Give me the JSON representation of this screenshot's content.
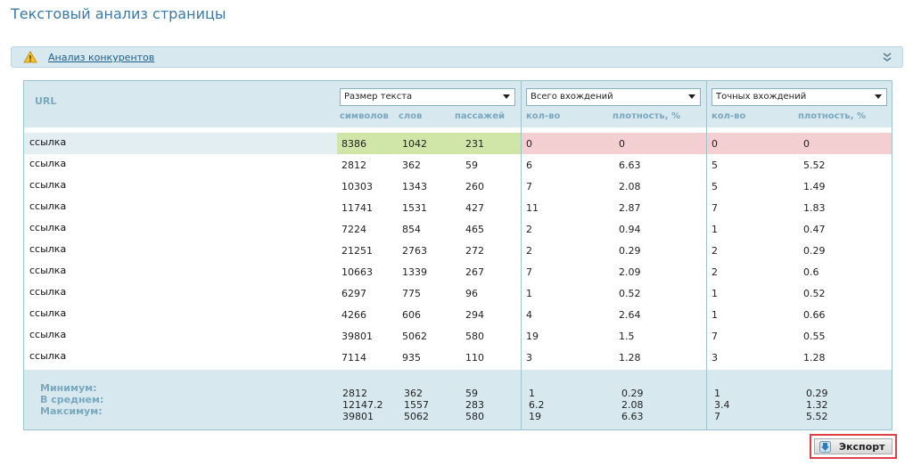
{
  "page": {
    "title": "Текстовый анализ страницы"
  },
  "competitors": {
    "link_label": "Анализ конкурентов",
    "warning_icon": "warning-icon",
    "collapse_icon": "double-chevron-icon"
  },
  "table": {
    "url_header": "URL",
    "groups": [
      {
        "select_value": "Размер текста",
        "subcols": [
          "символов",
          "слов",
          "пассажей"
        ]
      },
      {
        "select_value": "Всего вхождений",
        "subcols": [
          "кол-во",
          "плотность, %"
        ]
      },
      {
        "select_value": "Точных вхождений",
        "subcols": [
          "кол-во",
          "плотность, %"
        ]
      }
    ],
    "rows": [
      {
        "url": "ссылка",
        "symbols": "8386",
        "words": "1042",
        "passages": "231",
        "total_count": "0",
        "total_density": "0",
        "exact_count": "0",
        "exact_density": "0"
      },
      {
        "url": "ссылка",
        "symbols": "2812",
        "words": "362",
        "passages": "59",
        "total_count": "6",
        "total_density": "6.63",
        "exact_count": "5",
        "exact_density": "5.52"
      },
      {
        "url": "ссылка",
        "symbols": "10303",
        "words": "1343",
        "passages": "260",
        "total_count": "7",
        "total_density": "2.08",
        "exact_count": "5",
        "exact_density": "1.49"
      },
      {
        "url": "ссылка",
        "symbols": "11741",
        "words": "1531",
        "passages": "427",
        "total_count": "11",
        "total_density": "2.87",
        "exact_count": "7",
        "exact_density": "1.83"
      },
      {
        "url": "ссылка",
        "symbols": "7224",
        "words": "854",
        "passages": "465",
        "total_count": "2",
        "total_density": "0.94",
        "exact_count": "1",
        "exact_density": "0.47"
      },
      {
        "url": "ссылка",
        "symbols": "21251",
        "words": "2763",
        "passages": "272",
        "total_count": "2",
        "total_density": "0.29",
        "exact_count": "2",
        "exact_density": "0.29"
      },
      {
        "url": "ссылка",
        "symbols": "10663",
        "words": "1339",
        "passages": "267",
        "total_count": "7",
        "total_density": "2.09",
        "exact_count": "2",
        "exact_density": "0.6"
      },
      {
        "url": "ссылка",
        "symbols": "6297",
        "words": "775",
        "passages": "96",
        "total_count": "1",
        "total_density": "0.52",
        "exact_count": "1",
        "exact_density": "0.52"
      },
      {
        "url": "ссылка",
        "symbols": "4266",
        "words": "606",
        "passages": "294",
        "total_count": "4",
        "total_density": "2.64",
        "exact_count": "1",
        "exact_density": "0.66"
      },
      {
        "url": "ссылка",
        "symbols": "39801",
        "words": "5062",
        "passages": "580",
        "total_count": "19",
        "total_density": "1.5",
        "exact_count": "7",
        "exact_density": "0.55"
      },
      {
        "url": "ссылка",
        "symbols": "7114",
        "words": "935",
        "passages": "110",
        "total_count": "3",
        "total_density": "1.28",
        "exact_count": "3",
        "exact_density": "1.28"
      }
    ],
    "summary": {
      "labels": [
        "Минимум:",
        "В среднем:",
        "Максимум:"
      ],
      "symbols": [
        "2812",
        "12147.2",
        "39801"
      ],
      "words": [
        "362",
        "1557",
        "5062"
      ],
      "passages": [
        "59",
        "283",
        "580"
      ],
      "total_count": [
        "1",
        "6.2",
        "19"
      ],
      "total_density": [
        "0.29",
        "2.08",
        "6.63"
      ],
      "exact_count": [
        "1",
        "3.4",
        "7"
      ],
      "exact_density": [
        "0.29",
        "1.32",
        "5.52"
      ]
    }
  },
  "export": {
    "label": "Экспорт",
    "icon": "export-arrow-icon"
  },
  "colors": {
    "accent": "#3a7aa8",
    "header_bg": "#d7e8ef",
    "highlight_green": "#cfe6a8",
    "highlight_red": "#f4cfd2",
    "export_frame": "#e0404a"
  }
}
